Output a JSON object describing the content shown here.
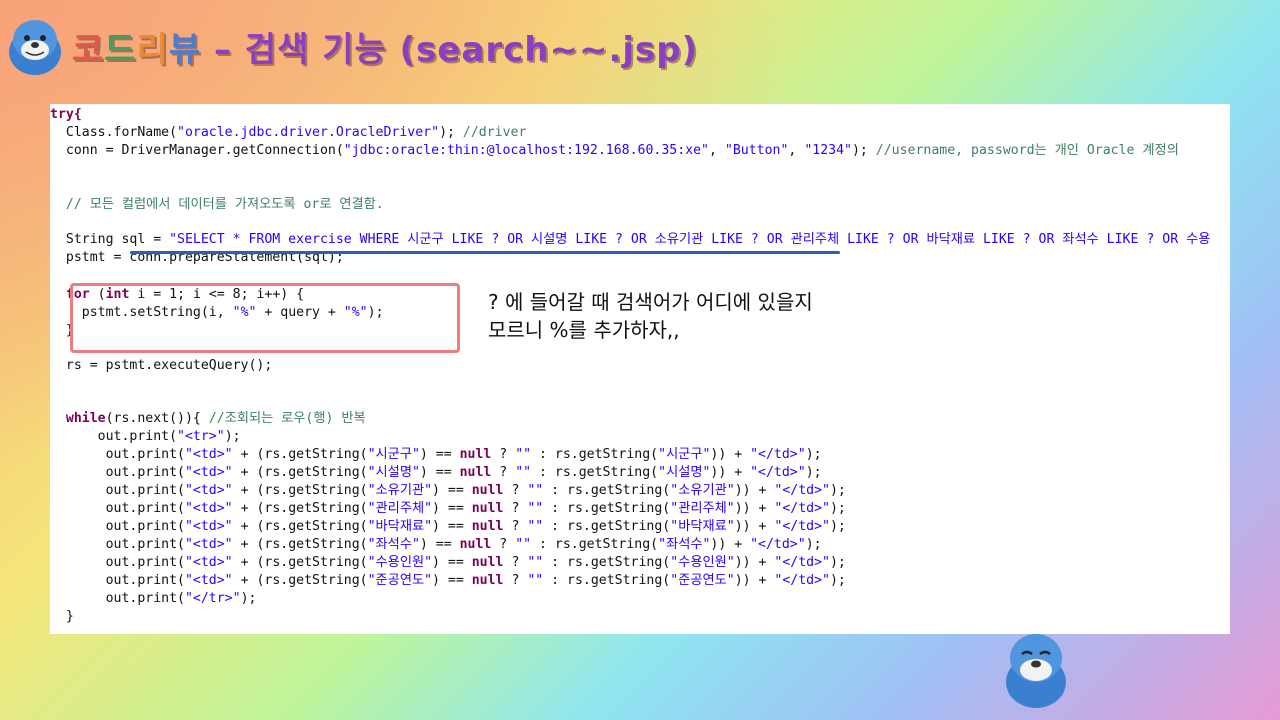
{
  "slide": {
    "title_parts": [
      "코",
      "드",
      "리",
      "뷰",
      " – 검색 기능 (search~~.jsp)"
    ],
    "annotation": "? 에 들어갈 때 검색어가 어디에 있을지 모르니 %를 추가하자,,",
    "mascot_icon": "seal-mascot",
    "accent_colors": {
      "keyword": "#7f0055",
      "string": "#2a00ff",
      "comment": "#3f7f5f",
      "underline": "#2f5fb0",
      "box": "#ef7c7c"
    }
  },
  "code": {
    "l1": "try{",
    "l2a": "  Class.forName(",
    "l2s": "\"oracle.jdbc.driver.OracleDriver\"",
    "l2b": "); ",
    "l2c": "//driver",
    "l3a": "  conn = DriverManager.getConnection(",
    "l3s1": "\"jdbc:oracle:thin:@localhost:192.168.60.35:xe\"",
    "l3b": ", ",
    "l3s2": "\"Button\"",
    "l3c": ", ",
    "l3s3": "\"1234\"",
    "l3d": "); ",
    "l3e": "//username, password는 개인 Oracle 계정의",
    "l4": "  // 모든 컬럼에서 데이터를 가져오도록 or로 연결함.",
    "l5a": "  String sql = ",
    "l5s": "\"SELECT * FROM exercise WHERE 시군구 LIKE ? OR 시설명 LIKE ? OR 소유기관 LIKE ? OR 관리주체 LIKE ? OR 바닥재료 LIKE ? OR 좌석수 LIKE ? OR 수용",
    "l6": "  pstmt = conn.prepareStatement(sql);",
    "l7k1": "for",
    "l7a": " (",
    "l7k2": "int",
    "l7b": " i = 1; i <= 8; i++) {",
    "l8a": "    pstmt.setString(i, ",
    "l8s1": "\"%\"",
    "l8b": " + query + ",
    "l8s2": "\"%\"",
    "l8c": ");",
    "l9": "  }",
    "l10": "  rs = pstmt.executeQuery();",
    "l11k": "while",
    "l11a": "(rs.next()){ ",
    "l11c": "//조회되는 로우(행) 반복",
    "l12a": "      out.print(",
    "l12s": "\"<tr>\"",
    "l12b": ");",
    "rows": [
      {
        "a": "       out.print(",
        "s1": "\"<td>\"",
        "b": " + (rs.getString(",
        "s2": "\"시군구\"",
        "c": ") == ",
        "k": "null",
        "d": " ? ",
        "s3": "\"\"",
        "e": " : rs.getString(",
        "s4": "\"시군구\"",
        "f": ")) + ",
        "s5": "\"</td>\"",
        "g": ");"
      },
      {
        "a": "       out.print(",
        "s1": "\"<td>\"",
        "b": " + (rs.getString(",
        "s2": "\"시설명\"",
        "c": ") == ",
        "k": "null",
        "d": " ? ",
        "s3": "\"\"",
        "e": " : rs.getString(",
        "s4": "\"시설명\"",
        "f": ")) + ",
        "s5": "\"</td>\"",
        "g": ");"
      },
      {
        "a": "       out.print(",
        "s1": "\"<td>\"",
        "b": " + (rs.getString(",
        "s2": "\"소유기관\"",
        "c": ") == ",
        "k": "null",
        "d": " ? ",
        "s3": "\"\"",
        "e": " : rs.getString(",
        "s4": "\"소유기관\"",
        "f": ")) + ",
        "s5": "\"</td>\"",
        "g": ");"
      },
      {
        "a": "       out.print(",
        "s1": "\"<td>\"",
        "b": " + (rs.getString(",
        "s2": "\"관리주체\"",
        "c": ") == ",
        "k": "null",
        "d": " ? ",
        "s3": "\"\"",
        "e": " : rs.getString(",
        "s4": "\"관리주체\"",
        "f": ")) + ",
        "s5": "\"</td>\"",
        "g": ");"
      },
      {
        "a": "       out.print(",
        "s1": "\"<td>\"",
        "b": " + (rs.getString(",
        "s2": "\"바닥재료\"",
        "c": ") == ",
        "k": "null",
        "d": " ? ",
        "s3": "\"\"",
        "e": " : rs.getString(",
        "s4": "\"바닥재료\"",
        "f": ")) + ",
        "s5": "\"</td>\"",
        "g": ");"
      },
      {
        "a": "       out.print(",
        "s1": "\"<td>\"",
        "b": " + (rs.getString(",
        "s2": "\"좌석수\"",
        "c": ") == ",
        "k": "null",
        "d": " ? ",
        "s3": "\"\"",
        "e": " : rs.getString(",
        "s4": "\"좌석수\"",
        "f": ")) + ",
        "s5": "\"</td>\"",
        "g": ");"
      },
      {
        "a": "       out.print(",
        "s1": "\"<td>\"",
        "b": " + (rs.getString(",
        "s2": "\"수용인원\"",
        "c": ") == ",
        "k": "null",
        "d": " ? ",
        "s3": "\"\"",
        "e": " : rs.getString(",
        "s4": "\"수용인원\"",
        "f": ")) + ",
        "s5": "\"</td>\"",
        "g": ");"
      },
      {
        "a": "       out.print(",
        "s1": "\"<td>\"",
        "b": " + (rs.getString(",
        "s2": "\"준공연도\"",
        "c": ") == ",
        "k": "null",
        "d": " ? ",
        "s3": "\"\"",
        "e": " : rs.getString(",
        "s4": "\"준공연도\"",
        "f": ")) + ",
        "s5": "\"</td>\"",
        "g": ");"
      }
    ],
    "l13a": "       out.print(",
    "l13s": "\"</tr>\"",
    "l13b": ");",
    "l14": "  }"
  }
}
